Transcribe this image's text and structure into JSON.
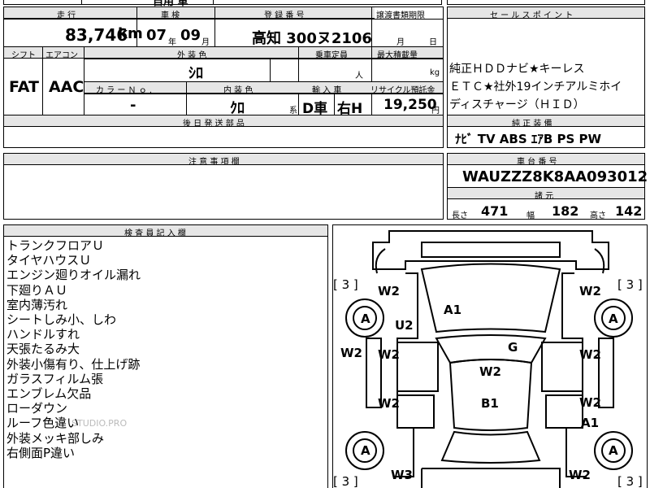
{
  "top_fragment": "自用 車",
  "mileage": {
    "header": "走 行",
    "value": "83,746",
    "unit": "km"
  },
  "inspection": {
    "header": "車 検",
    "year": "07",
    "year_unit": "年",
    "month": "09",
    "month_unit": "月"
  },
  "registration": {
    "header": "登 録 番 号",
    "value": "高知 300ヌ2106"
  },
  "transfer_deadline": {
    "header": "譲渡書類期限",
    "month_unit": "月",
    "day_unit": "日"
  },
  "sales_points": {
    "header": "セ ー ル ス ポ イ ン ト",
    "lines": [
      "純正ＨＤＤナビ★キーレス",
      "ＥＴＣ★社外19インチアルミホイ",
      "ディスチャージ（ＨＩＤ）"
    ]
  },
  "shift": {
    "header": "シフト",
    "value": "FAT"
  },
  "aircon": {
    "header": "エアコン",
    "value": "AAC"
  },
  "exterior_color": {
    "header": "外 装 色",
    "value": "ｼﾛ"
  },
  "capacity": {
    "header": "乗車定員",
    "unit": "人"
  },
  "max_load": {
    "header": "最大積載量",
    "unit": "kg"
  },
  "color_no": {
    "header": "カ ラ ー Ｎ ｏ .",
    "value": "-"
  },
  "interior_color": {
    "header": "内 装 色",
    "value": "ｸﾛ",
    "suffix": "系"
  },
  "import": {
    "header": "輸 入 車",
    "value1": "D車",
    "value2": "右H"
  },
  "recycle": {
    "header": "リサイクル預託金",
    "value": "19,250",
    "unit": "円"
  },
  "delivery_parts": {
    "header": "後 日 発 送 部 品"
  },
  "genuine_equipment": {
    "header": "純 正 装 備",
    "value": "ﾅﾋﾞ  TV  ABS  ｴｱB  PS  PW"
  },
  "notes": {
    "header": "注 意 事 項 欄"
  },
  "chassis": {
    "header": "車 台 番 号",
    "value": "WAUZZZ8K8AA093012"
  },
  "dimensions": {
    "header": "諸 元",
    "length_label": "長さ",
    "length": "471",
    "width_label": "幅",
    "width": "182",
    "height_label": "高さ",
    "height": "142"
  },
  "inspector": {
    "header": "検 査 員 記 入 欄",
    "remarks": [
      "トランクフロアＵ",
      "タイヤハウスＵ",
      "エンジン廻りオイル漏れ",
      "下廻りＡＵ",
      "室内薄汚れ",
      "シートしみ小、しわ",
      "ハンドルすれ",
      "天張たるみ大",
      "外装小傷有り、仕上げ跡",
      "ガラスフィルム張",
      "エンブレム欠品",
      "ローダウン",
      "ルーフ色違い",
      "外装メッキ部しみ",
      "右側面P違い"
    ],
    "watermark": "STUDIO.PRO"
  },
  "diagram": {
    "labels": [
      "[ 3 ]",
      "[ 3 ]",
      "[ 3 ]",
      "[ 3 ]",
      "W2",
      "W2",
      "A1",
      "U2",
      "A",
      "A",
      "W2",
      "W2",
      "G",
      "W2",
      "W2",
      "W2",
      "B1",
      "W2",
      "A1",
      "A",
      "A",
      "W3",
      "W2"
    ]
  }
}
